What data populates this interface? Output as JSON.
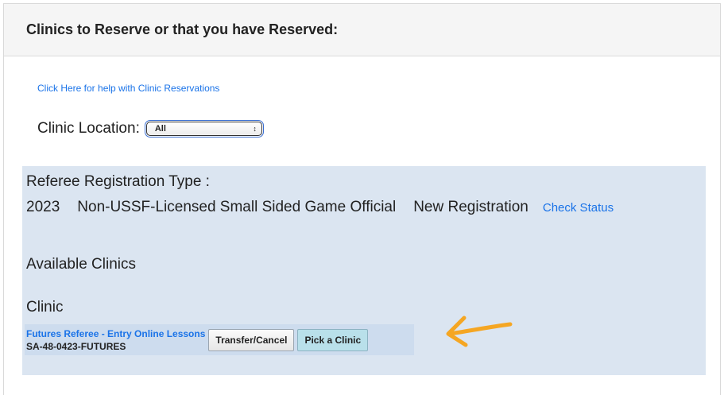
{
  "header": {
    "title": "Clinics to Reserve or that you have Reserved:"
  },
  "help_link": "Click Here for help with Clinic Reservations",
  "location": {
    "label": "Clinic Location:",
    "selected": "All"
  },
  "registration": {
    "label": "Referee Registration Type :",
    "year": "2023",
    "type": "Non-USSF-Licensed Small Sided Game Official",
    "status": "New Registration",
    "check_status": "Check Status"
  },
  "available_clinics_label": "Available Clinics",
  "clinic_label": "Clinic",
  "clinic": {
    "name": "Futures Referee - Entry Online Lessons",
    "code": "SA-48-0423-FUTURES",
    "transfer_button": "Transfer/Cancel",
    "pick_button": "Pick a Clinic"
  },
  "annotation": {
    "arrow_color": "#f5a623",
    "icon": "hand-drawn-arrow-icon"
  }
}
